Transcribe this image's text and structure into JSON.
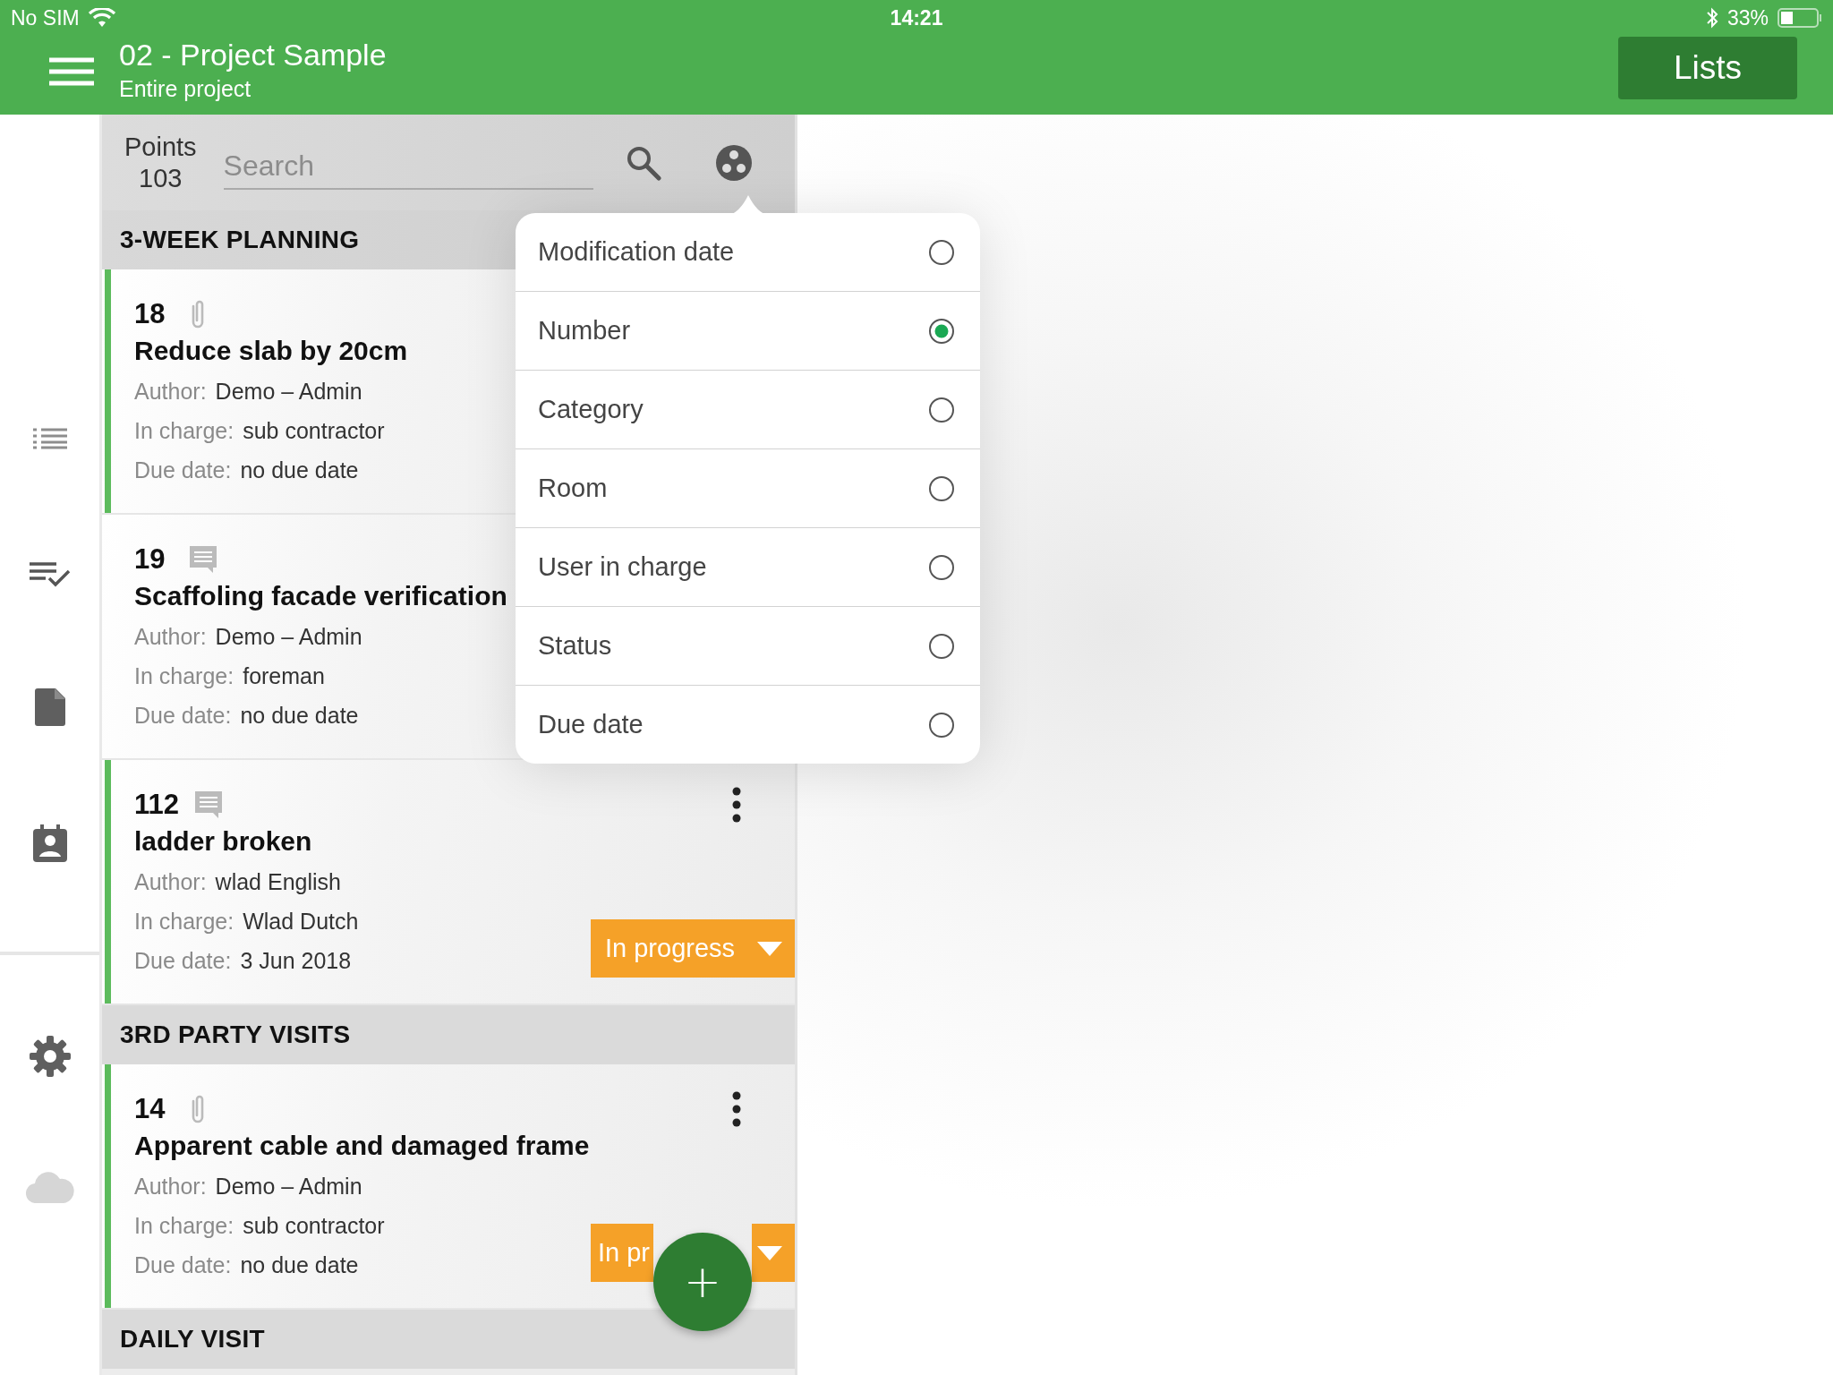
{
  "status_bar": {
    "carrier": "No SIM",
    "time": "14:21",
    "battery": "33%"
  },
  "header": {
    "title": "02 - Project Sample",
    "subtitle": "Entire project",
    "button": "Lists"
  },
  "list_header": {
    "label": "Points",
    "count": "103",
    "search": {
      "placeholder": "Search"
    }
  },
  "sections": [
    {
      "title": "3-WEEK PLANNING",
      "cards": [
        {
          "number": "18",
          "kind": "attachment",
          "title": "Reduce slab by 20cm",
          "marked": true,
          "fields": [
            {
              "label": "Author:",
              "value": "Demo – Admin"
            },
            {
              "label": "In charge:",
              "value": "sub contractor"
            },
            {
              "label": "Due date:",
              "value": "no due date"
            }
          ]
        },
        {
          "number": "19",
          "kind": "comment",
          "title": "Scaffoling facade verification",
          "marked": false,
          "fields": [
            {
              "label": "Author:",
              "value": "Demo – Admin"
            },
            {
              "label": "In charge:",
              "value": "foreman"
            },
            {
              "label": "Due date:",
              "value": "no due date"
            }
          ]
        },
        {
          "number": "112",
          "kind": "comment",
          "title": "ladder broken",
          "marked": true,
          "menu": true,
          "status": "In progress",
          "fields": [
            {
              "label": "Author:",
              "value": "wlad English"
            },
            {
              "label": "In charge:",
              "value": "Wlad Dutch"
            },
            {
              "label": "Due date:",
              "value": "3 Jun 2018"
            }
          ]
        }
      ]
    },
    {
      "title": "3RD PARTY VISITS",
      "cards": [
        {
          "number": "14",
          "kind": "attachment",
          "title": "Apparent cable and damaged frame",
          "marked": true,
          "menu": true,
          "status": "In pr",
          "fields": [
            {
              "label": "Author:",
              "value": "Demo – Admin"
            },
            {
              "label": "In charge:",
              "value": "sub contractor"
            },
            {
              "label": "Due date:",
              "value": "no due date"
            }
          ]
        }
      ]
    },
    {
      "title": "DAILY VISIT"
    }
  ],
  "sort_menu": {
    "options": [
      {
        "label": "Modification date",
        "selected": false
      },
      {
        "label": "Number",
        "selected": true
      },
      {
        "label": "Category",
        "selected": false
      },
      {
        "label": "Room",
        "selected": false
      },
      {
        "label": "User in charge",
        "selected": false
      },
      {
        "label": "Status",
        "selected": false
      },
      {
        "label": "Due date",
        "selected": false
      }
    ]
  },
  "fab": {
    "label": "+"
  }
}
